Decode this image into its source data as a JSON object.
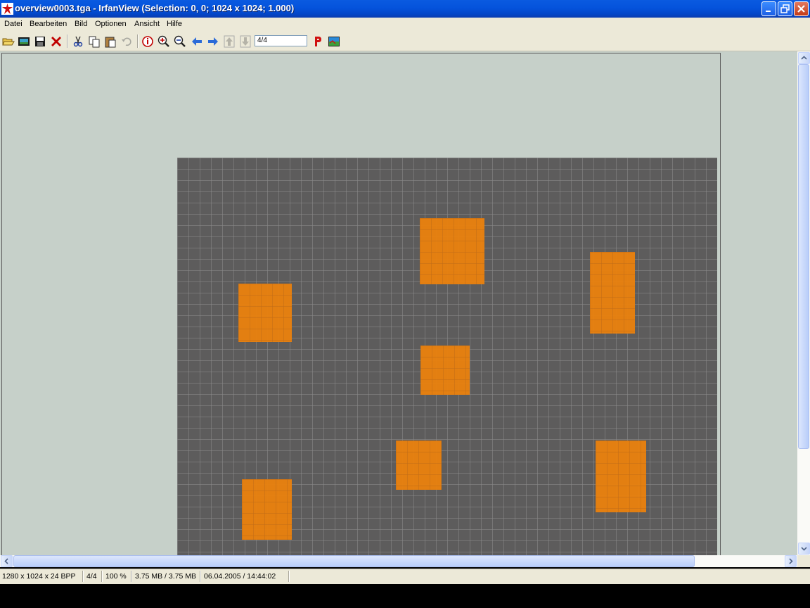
{
  "window": {
    "title": "overview0003.tga - IrfanView (Selection: 0, 0; 1024 x 1024; 1.000)"
  },
  "menu": [
    "Datei",
    "Bearbeiten",
    "Bild",
    "Optionen",
    "Ansicht",
    "Hilfe"
  ],
  "toolbar": {
    "page_field_value": "4/4",
    "icons": [
      "open-icon",
      "slideshow-icon",
      "save-icon",
      "delete-icon",
      "cut-icon",
      "copy-icon",
      "paste-icon",
      "undo-icon",
      "info-icon",
      "zoom-in-icon",
      "zoom-out-icon",
      "previous-icon",
      "next-icon",
      "first-page-icon",
      "last-page-icon",
      "print-icon",
      "irfanview-logo-icon"
    ]
  },
  "status": {
    "dimensions": "1280 x 1024 x 24 BPP",
    "page": "4/4",
    "zoom": "100 %",
    "size": "3.75 MB / 3.75 MB",
    "date": "06.04.2005 / 14:44:02"
  },
  "colors": {
    "titlebar": "#0553dc",
    "map_background": "#5d5c5c",
    "block": "#e8810f",
    "viewport_background": "#c6d0c9"
  }
}
